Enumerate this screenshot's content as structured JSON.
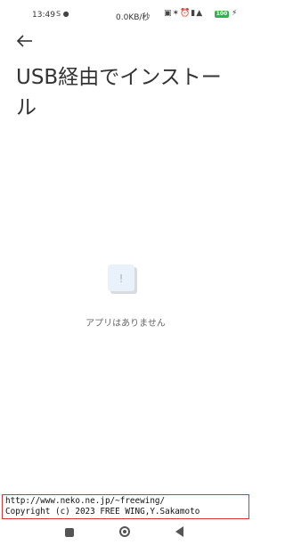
{
  "status_bar": {
    "time": "13:49",
    "speed": "0.0KB/秒",
    "battery": "100"
  },
  "page": {
    "title": "USB経由でインストール"
  },
  "empty_state": {
    "icon_glyph": "!",
    "message": "アプリはありません"
  },
  "watermark": {
    "line1": "http://www.neko.ne.jp/~freewing/",
    "line2": "Copyright (c) 2023 FREE WING,Y.Sakamoto"
  }
}
